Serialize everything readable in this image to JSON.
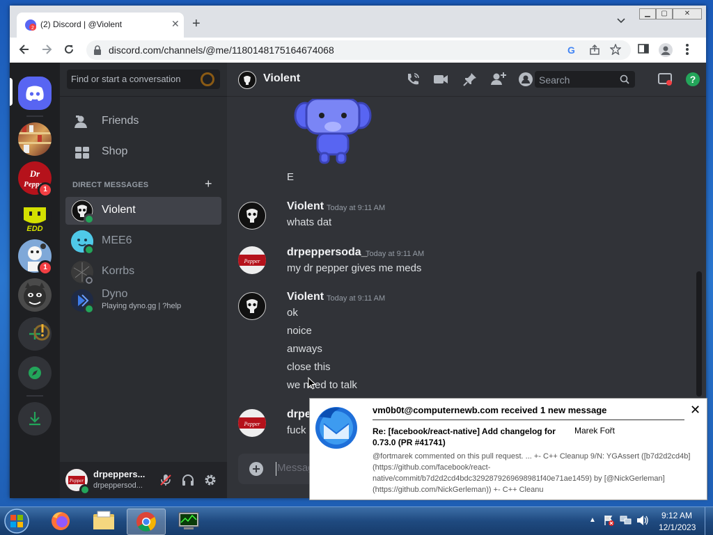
{
  "browser": {
    "tab_title": "(2) Discord | @Violent",
    "tab_badge": "2",
    "url": "discord.com/channels/@me/1180148175164674068"
  },
  "discord": {
    "search_placeholder": "Find or start a conversation",
    "nav": {
      "friends": "Friends",
      "shop": "Shop"
    },
    "dm_header": "DIRECT MESSAGES",
    "dms": [
      {
        "name": "Violent",
        "status": "online",
        "sub": ""
      },
      {
        "name": "MEE6",
        "status": "online",
        "sub": ""
      },
      {
        "name": "Korrbs",
        "status": "offline",
        "sub": ""
      },
      {
        "name": "Dyno",
        "status": "online",
        "sub": "Playing dyno.gg | ?help"
      }
    ],
    "guild_badges": [
      "1",
      "1"
    ],
    "user": {
      "name": "drpeppers...",
      "sub": "drpeppersod..."
    },
    "channel_name": "Violent",
    "header_search": "Search",
    "sticker_caption": "E",
    "messages": [
      {
        "author": "Violent",
        "time": "Today at 9:11 AM",
        "lines": [
          "whats dat"
        ]
      },
      {
        "author": "drpeppersoda_",
        "time": "Today at 9:11 AM",
        "lines": [
          "my dr pepper gives me meds"
        ]
      },
      {
        "author": "Violent",
        "time": "Today at 9:11 AM",
        "lines": [
          "ok",
          "noice",
          "anways",
          "close this",
          "we need to talk"
        ]
      },
      {
        "author": "drpepp",
        "time": "",
        "lines": [
          "fuck pe"
        ]
      }
    ],
    "composer_placeholder": "Messag"
  },
  "notification": {
    "title": "vm0b0t@computernewb.com received 1 new message",
    "subject": "Re: [facebook/react-native] Add changelog for 0.73.0 (PR #41741)",
    "from": "Marek Fořt",
    "body": "@fortmarek commented on this pull request. ... +- C++ Cleanup 9/N: YGAssert ([b7d2d2cd4b](https://github.com/facebook/react-native/commit/b7d2d2cd4bdc3292879269698981f40e71ae1459) by [@NickGerleman](https://github.com/NickGerleman)) +- C++ Cleanu"
  },
  "taskbar": {
    "time": "9:12 AM",
    "date": "12/1/2023"
  },
  "colors": {
    "blurple": "#5865f2",
    "green": "#23a55a",
    "red": "#f23f43",
    "bg": "#313338"
  }
}
